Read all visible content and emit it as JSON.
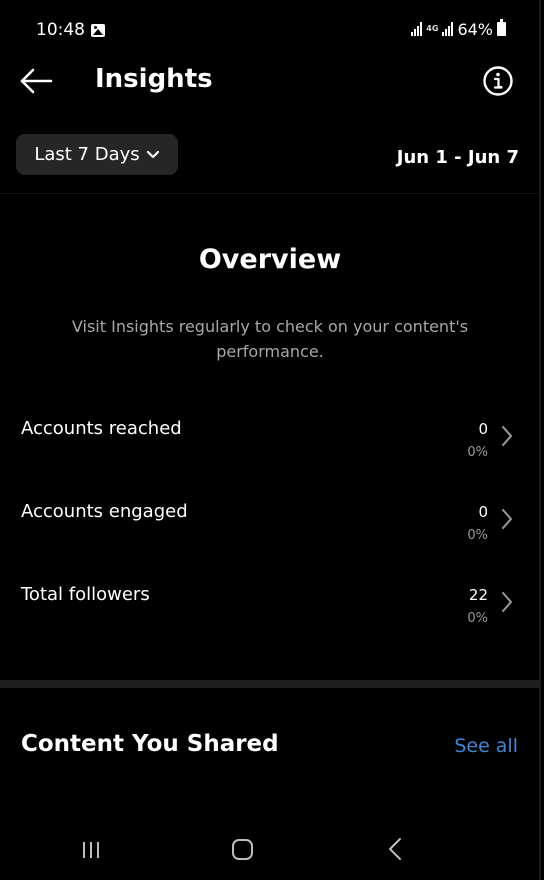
{
  "status_bar": {
    "time": "10:48",
    "network": "4G",
    "battery": "64%"
  },
  "header": {
    "title": "Insights",
    "back_icon": "arrow-left-icon",
    "info_icon": "info-circle-icon"
  },
  "filter": {
    "range_label": "Last 7 Days",
    "date_range": "Jun 1 - Jun 7"
  },
  "overview": {
    "title": "Overview",
    "description": "Visit Insights regularly to check on your content's performance.",
    "metrics": [
      {
        "label": "Accounts reached",
        "value": "0",
        "change": "0%"
      },
      {
        "label": "Accounts engaged",
        "value": "0",
        "change": "0%"
      },
      {
        "label": "Total followers",
        "value": "22",
        "change": "0%"
      }
    ]
  },
  "content_shared": {
    "title": "Content You Shared",
    "see_all": "See all"
  },
  "colors": {
    "background": "#000000",
    "accent_link": "#3d87d6",
    "pill": "#262626",
    "muted_text": "#a8a8a8"
  },
  "nav_bar": {
    "recents_icon": "recent-apps-icon",
    "home_icon": "home-icon",
    "back_icon": "back-icon"
  }
}
